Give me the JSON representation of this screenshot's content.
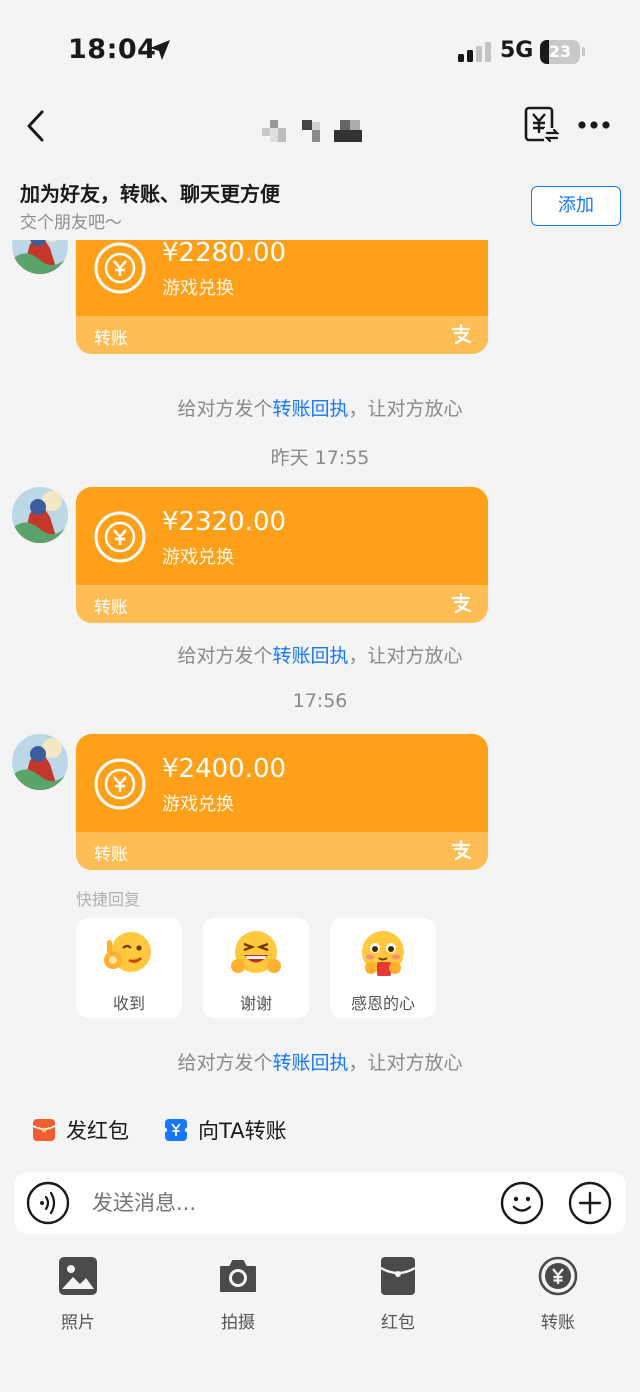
{
  "status_bar": {
    "time": "18:04",
    "network": "5G",
    "battery": "23",
    "battery_level": 0.23
  },
  "header": {
    "back_icon": "chevron-left-icon",
    "title_masked": true,
    "receipt_icon": "yuan-receipt-icon",
    "more_icon": "more-icon"
  },
  "friend_banner": {
    "title": "加为好友，转账、聊天更方便",
    "subtitle": "交个朋友吧～",
    "add_label": "添加"
  },
  "messages": [
    {
      "amount": "¥2280.00",
      "desc": "游戏兑换",
      "label": "转账",
      "hint_prefix": "给对方发个",
      "hint_link": "转账回执",
      "hint_suffix": "，让对方放心"
    },
    {
      "time": "昨天 17:55",
      "amount": "¥2320.00",
      "desc": "游戏兑换",
      "label": "转账",
      "hint_prefix": "给对方发个",
      "hint_link": "转账回执",
      "hint_suffix": "，让对方放心"
    },
    {
      "time": "17:56",
      "amount": "¥2400.00",
      "desc": "游戏兑换",
      "label": "转账"
    }
  ],
  "quick_reply": {
    "label": "快捷回复",
    "items": [
      {
        "text": "收到",
        "icon": "ok-emoji-icon"
      },
      {
        "text": "谢谢",
        "icon": "laugh-emoji-icon"
      },
      {
        "text": "感恩的心",
        "icon": "grateful-emoji-icon"
      }
    ]
  },
  "bottom_hint": {
    "prefix": "给对方发个",
    "link": "转账回执",
    "suffix": "，让对方放心"
  },
  "actions": {
    "red_packet": "发红包",
    "transfer": "向TA转账"
  },
  "input": {
    "placeholder": "发送消息..."
  },
  "tools": [
    {
      "label": "照片",
      "icon": "photo-icon"
    },
    {
      "label": "拍摄",
      "icon": "camera-icon"
    },
    {
      "label": "红包",
      "icon": "red-packet-icon"
    },
    {
      "label": "转账",
      "icon": "transfer-icon"
    }
  ],
  "colors": {
    "card": "#ffa01a",
    "card_footer": "#ffbd55",
    "link": "#1677ff",
    "background": "#f4f4f4"
  }
}
